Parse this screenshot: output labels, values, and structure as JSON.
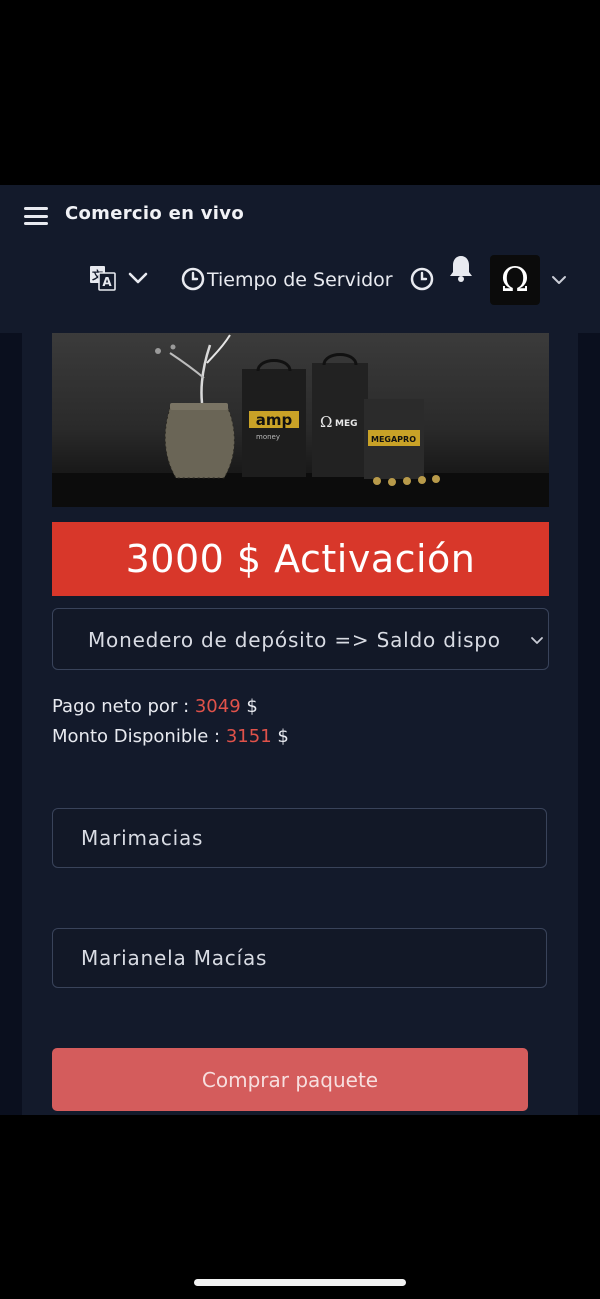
{
  "header": {
    "app_title": "Comercio en vivo",
    "server_time_label": "Tiempo de Servidor",
    "menu_icon": "hamburger-menu-icon",
    "language_icon": "translate-icon",
    "clock_icon": "clock-icon",
    "notification_icon": "bell-icon",
    "avatar_glyph": "Ω"
  },
  "banner": {
    "logo_amp_text": "amp",
    "logo_money_text": "money",
    "logo_mega_text": "MEG",
    "logo_megapro_text": "MEGAPRO",
    "omega_glyph": "Ω"
  },
  "package": {
    "title": "3000 $ Activación",
    "wallet_select_value": "Monedero de depósito => Saldo dispo",
    "net_payment_label": "Pago neto por : ",
    "net_payment_value": "3049",
    "available_label": "Monto Disponible : ",
    "available_value": "3151",
    "currency": "$",
    "username_value": "Marimacias",
    "fullname_value": "Marianela Macías",
    "buy_button_label": "Comprar paquete"
  },
  "colors": {
    "activation_bar": "#d8372a",
    "buy_button": "#d45c5c",
    "amount_highlight": "#e0524a",
    "panel_bg": "#131a2b"
  }
}
